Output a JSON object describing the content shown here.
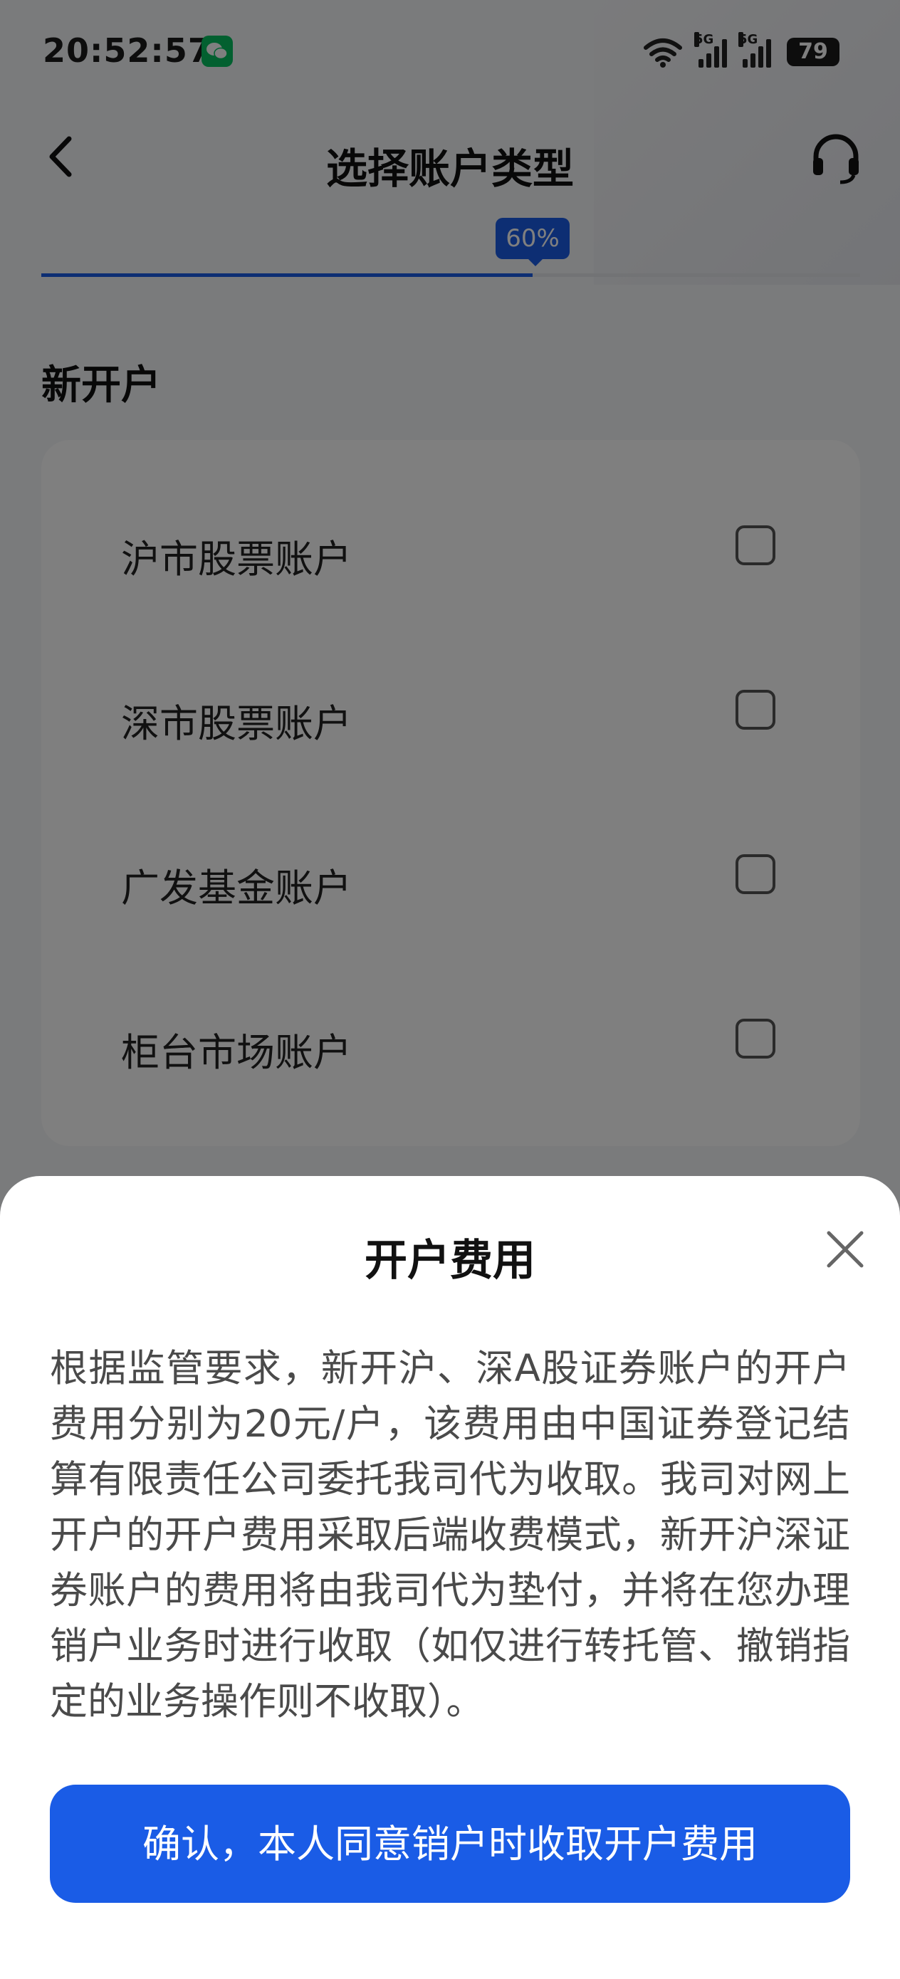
{
  "status_bar": {
    "time": "20:52:57",
    "network_1": "5G",
    "network_2": "5G",
    "battery": "79"
  },
  "header": {
    "title": "选择账户类型",
    "back_icon": "back-arrow-icon",
    "service_icon": "headset-icon"
  },
  "progress": {
    "label": "60%",
    "value": 0.6,
    "color": "#1a5ce6"
  },
  "section": {
    "title": "新开户"
  },
  "accounts": [
    {
      "label": "沪市股票账户",
      "checked": false
    },
    {
      "label": "深市股票账户",
      "checked": false
    },
    {
      "label": "广发基金账户",
      "checked": false
    },
    {
      "label": "柜台市场账户",
      "checked": false
    }
  ],
  "sheet": {
    "title": "开户费用",
    "body": "根据监管要求，新开沪、深A股证券账户的开户费用分别为20元/户，该费用由中国证券登记结算有限责任公司委托我司代为收取。我司对网上开户的开户费用采取后端收费模式，新开沪深证券账户的费用将由我司代为垫付，并将在您办理销户业务时进行收取（如仅进行转托管、撤销指定的业务操作则不收取）。",
    "confirm_label": "确认，本人同意销户时收取开户费用",
    "close_icon": "close-icon"
  },
  "colors": {
    "accent": "#1a5ce6"
  }
}
